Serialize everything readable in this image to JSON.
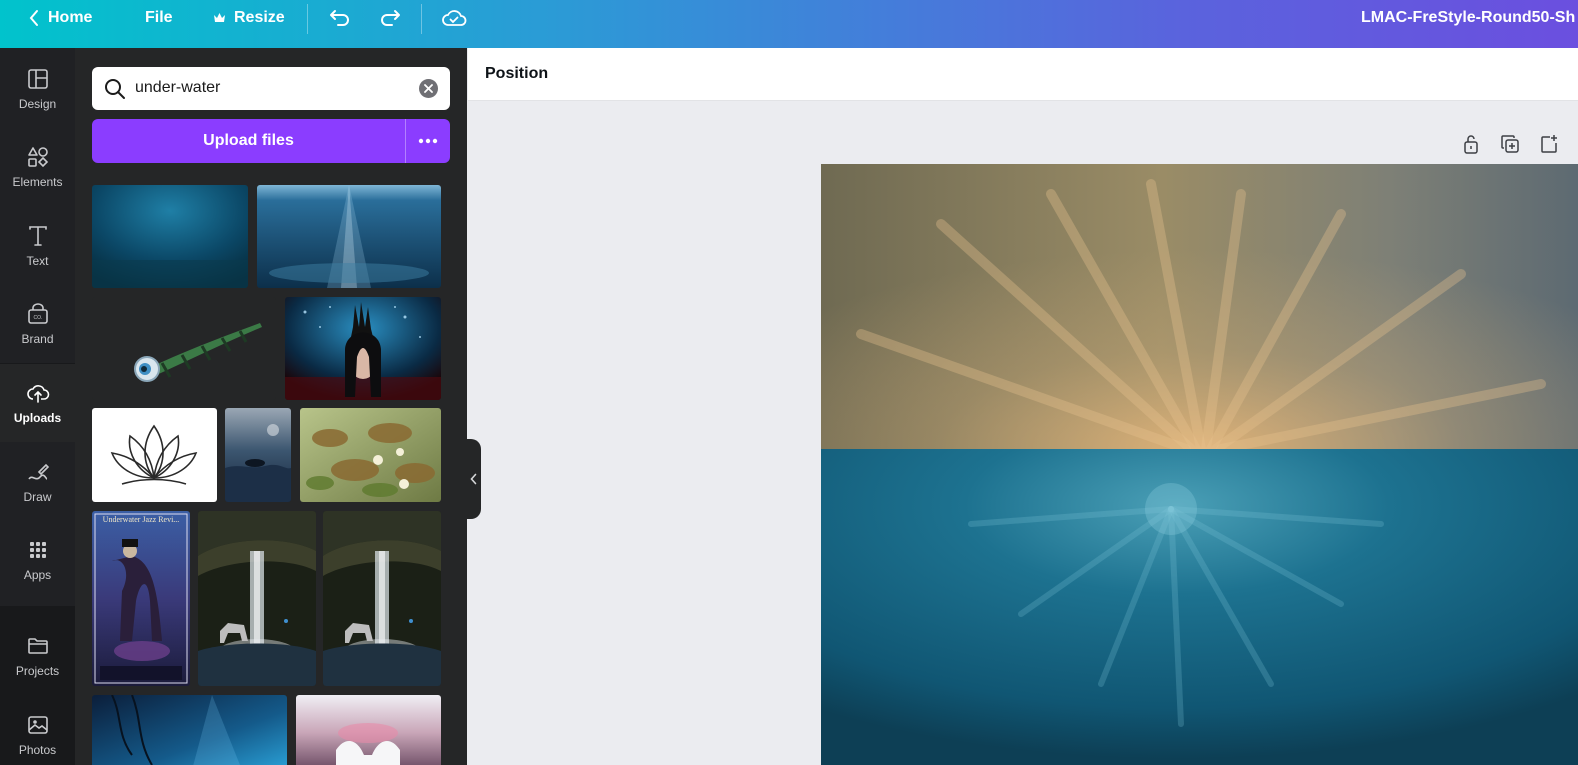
{
  "topbar": {
    "home_label": "Home",
    "file_label": "File",
    "resize_label": "Resize",
    "doc_title": "LMAC-FreStyle-Round50-Sh"
  },
  "rail": {
    "items": [
      {
        "label": "Design",
        "icon": "layout-icon"
      },
      {
        "label": "Elements",
        "icon": "shapes-icon"
      },
      {
        "label": "Text",
        "icon": "text-t-icon"
      },
      {
        "label": "Brand",
        "icon": "brand-icon"
      },
      {
        "label": "Uploads",
        "icon": "cloud-upload-icon",
        "active": true
      },
      {
        "label": "Draw",
        "icon": "draw-icon"
      },
      {
        "label": "Apps",
        "icon": "apps-grid-icon"
      },
      {
        "label": "Projects",
        "icon": "folder-icon"
      },
      {
        "label": "Photos",
        "icon": "image-icon"
      }
    ]
  },
  "panel": {
    "search_value": "under-water",
    "upload_label": "Upload files",
    "thumb_text": "Underwater Jazz Revi..."
  },
  "toolbar": {
    "position_label": "Position"
  },
  "colors": {
    "accent": "#8b3dff",
    "rail_bg": "#18191b",
    "panel_bg": "#252627",
    "gradient_start": "#01c3cc",
    "gradient_end": "#6b4fdf"
  }
}
